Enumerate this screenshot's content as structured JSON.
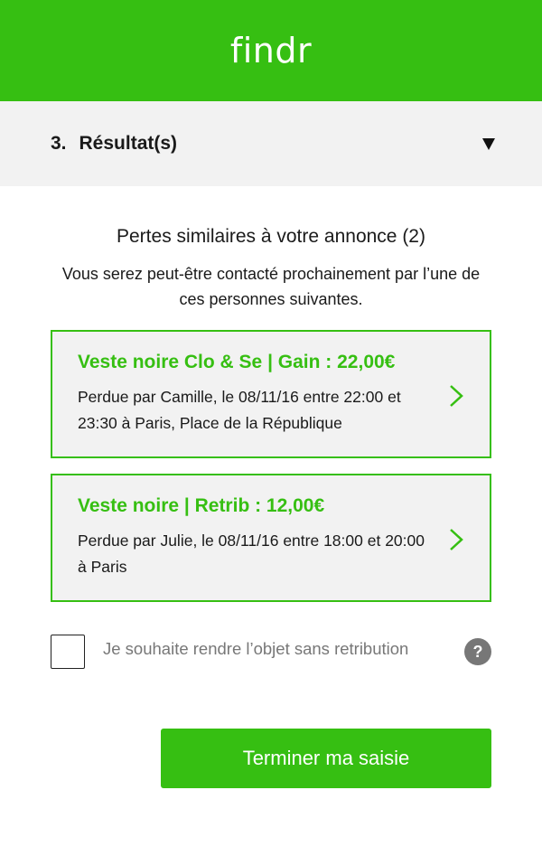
{
  "header": {
    "logo": "findr",
    "bg_color": "#36bf12"
  },
  "step": {
    "number": "3.",
    "title": "Résultat(s)",
    "toggle_icon": "triangle-down-icon"
  },
  "results": {
    "heading": "Pertes similaires à votre annonce (2)",
    "subheading": "Vous serez peut-être contacté prochainement par l’une de ces personnes suivantes.",
    "items": [
      {
        "title": "Veste noire Clo & Se | Gain : 22,00€",
        "description": "Perdue par Camille, le 08/11/16 entre 22:00 et 23:30 à Paris, Place de la République",
        "icon": "chevron-right-icon"
      },
      {
        "title": "Veste noire | Retrib : 12,00€",
        "description": "Perdue par Julie, le 08/11/16 entre 18:00 et 20:00 à Paris",
        "icon": "chevron-right-icon"
      }
    ]
  },
  "no_reward": {
    "label": "Je souhaite rendre l’objet sans retribution",
    "checked": false,
    "help_icon": "?"
  },
  "submit": {
    "label": "Terminer ma saisie"
  },
  "colors": {
    "accent": "#36bf12",
    "panel": "#f2f2f2",
    "muted": "#777777"
  }
}
